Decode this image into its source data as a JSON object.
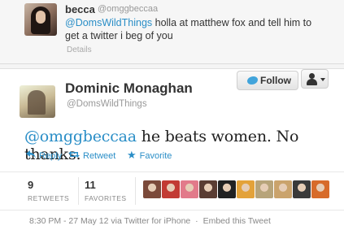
{
  "reply_tweet": {
    "name": "becca",
    "handle": "@omggbeccaa",
    "mention": "@DomsWildThings",
    "text_1": " holla at matthew fox and tell him to",
    "text_2": "get a twitter i beg of you",
    "details_label": "Details"
  },
  "main_tweet": {
    "name": "Dominic Monaghan",
    "handle": "@DomsWildThings",
    "follow_label": "Follow",
    "mention": "@omggbeccaa",
    "text": " he beats women. No thanks.",
    "actions": {
      "reply_label": "Reply",
      "retweet_label": "Retweet",
      "favorite_label": "Favorite",
      "reply_icon": "reply-arrow-icon",
      "retweet_icon": "retweet-icon",
      "favorite_icon": "star-icon"
    },
    "stats": {
      "retweets_count": "9",
      "retweets_label": "RETWEETS",
      "favorites_count": "11",
      "favorites_label": "FAVORITES"
    },
    "favoriter_avatar_colors": [
      "#7b4a3a",
      "#c23b34",
      "#e27a8a",
      "#5a3d33",
      "#222222",
      "#e3a23a",
      "#b7a47a",
      "#caa36c",
      "#3a3a3a",
      "#d76b2a"
    ],
    "footer": {
      "timestamp": "8:30 PM - 27 May 12",
      "via": "via Twitter for iPhone",
      "separator": "·",
      "embed_label": "Embed this Tweet"
    }
  },
  "colors": {
    "link": "#2a8ec7",
    "name": "#333333",
    "muted": "#999999"
  }
}
